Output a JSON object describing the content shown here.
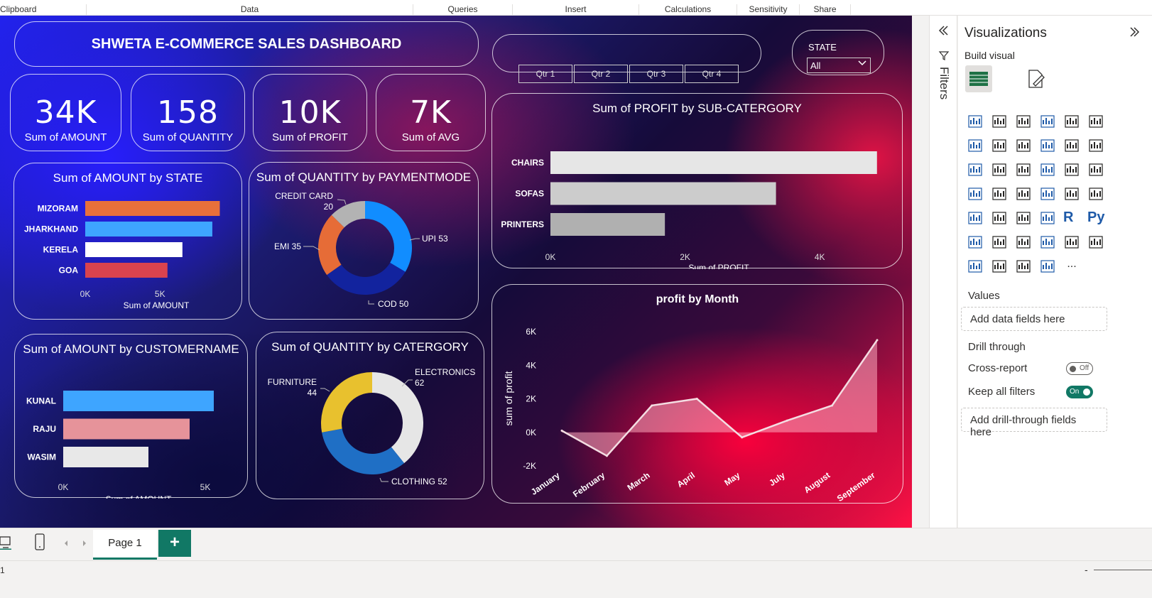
{
  "ribbon": {
    "groups": [
      "Clipboard",
      "Data",
      "Queries",
      "Insert",
      "Calculations",
      "Sensitivity",
      "Share"
    ]
  },
  "dashboard": {
    "title": "SHWETA E-COMMERCE SALES DASHBOARD",
    "quarters": [
      "Qtr 1",
      "Qtr 2",
      "Qtr 3",
      "Qtr 4"
    ],
    "state_slicer": {
      "label": "STATE",
      "value": "All"
    },
    "kpis": [
      {
        "value": "34K",
        "label": "Sum of AMOUNT"
      },
      {
        "value": "158",
        "label": "Sum of QUANTITY"
      },
      {
        "value": "10K",
        "label": "Sum of PROFIT"
      },
      {
        "value": "7K",
        "label": "Sum of AVG"
      }
    ]
  },
  "chart_data": [
    {
      "type": "bar",
      "title": "Sum of AMOUNT by STATE",
      "categories": [
        "MIZORAM",
        "JHARKHAND",
        "KERELA",
        "GOA"
      ],
      "values": [
        9000,
        8500,
        6500,
        5500
      ],
      "colors": [
        "#e8703a",
        "#3ea5ff",
        "#ffffff",
        "#d9434e"
      ],
      "xlabel": "Sum of AMOUNT",
      "ticks": [
        "0K",
        "5K"
      ],
      "xlim": [
        0,
        9500
      ]
    },
    {
      "type": "pie",
      "title": "Sum of QUANTITY by PAYMENTMODE",
      "labels": [
        "UPI",
        "COD",
        "EMI",
        "CREDIT CARD"
      ],
      "values": [
        53,
        50,
        35,
        20
      ],
      "colors": [
        "#118dff",
        "#12239e",
        "#e66c37",
        "#b3b3b3"
      ]
    },
    {
      "type": "bar",
      "title": "Sum of PROFIT by SUB-CATERGORY",
      "categories": [
        "CHAIRS",
        "SOFAS",
        "PRINTERS"
      ],
      "values": [
        4850,
        3350,
        1700
      ],
      "colors": [
        "#e6e6e6",
        "#cccccc",
        "#b0b0b0"
      ],
      "xlabel": "Sum of PROFIT",
      "ticks": [
        "0K",
        "2K",
        "4K"
      ],
      "xlim": [
        0,
        5000
      ]
    },
    {
      "type": "bar",
      "title": "Sum of AMOUNT by CUSTOMERNAME",
      "categories": [
        "KUNAL",
        "RAJU",
        "WASIM"
      ],
      "values": [
        5300,
        4450,
        3000
      ],
      "colors": [
        "#3ea5ff",
        "#e6939a",
        "#e8e8e8"
      ],
      "xlabel": "Sum of AMOUNT",
      "ticks": [
        "0K",
        "5K"
      ],
      "xlim": [
        0,
        5300
      ]
    },
    {
      "type": "pie",
      "title": "Sum of QUANTITY by CATERGORY",
      "labels": [
        "ELECTRONICS",
        "CLOTHING",
        "FURNITURE"
      ],
      "values": [
        62,
        52,
        44
      ],
      "colors": [
        "#e6e6e6",
        "#1f6fc5",
        "#e8c12e"
      ]
    },
    {
      "type": "area",
      "title": "profit by Month",
      "categories": [
        "January",
        "February",
        "March",
        "April",
        "May",
        "July",
        "August",
        "September"
      ],
      "values": [
        100,
        -1400,
        1600,
        2000,
        -300,
        700,
        1600,
        5500
      ],
      "ylabel": "sum of profit",
      "yticks": [
        "6K",
        "4K",
        "2K",
        "0K",
        "-2K"
      ],
      "ylim": [
        -2000,
        6000
      ]
    }
  ],
  "filters_pane": {
    "label": "Filters"
  },
  "viz_pane": {
    "title": "Visualizations",
    "build_visual": "Build visual",
    "values_label": "Values",
    "add_data": "Add data fields here",
    "drill_through": "Drill through",
    "cross_report": "Cross-report",
    "cross_report_state": "Off",
    "keep_filters": "Keep all filters",
    "keep_filters_state": "On",
    "add_drill": "Add drill-through fields here",
    "more": "..."
  },
  "pages": {
    "tab": "Page 1",
    "add": "+"
  },
  "status": {
    "page_number": "1",
    "zoom_minus": "-"
  }
}
